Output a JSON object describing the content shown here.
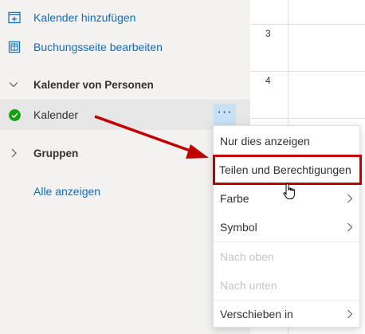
{
  "nav": {
    "add_calendar": {
      "label": "Kalender hinzufügen",
      "icon": "calendar-add-icon"
    },
    "booking_page": {
      "label": "Buchungsseite bearbeiten",
      "icon": "booking-page-icon"
    },
    "people_section": {
      "label": "Kalender von Personen",
      "icon": "chevron-down-icon"
    },
    "calendar_item": {
      "label": "Kalender",
      "checked": true,
      "more_icon": "more-horizontal-icon"
    },
    "groups_section": {
      "label": "Gruppen",
      "icon": "chevron-right-icon"
    },
    "show_all": {
      "label": "Alle anzeigen"
    }
  },
  "grid": {
    "day_numbers": [
      "3",
      "4"
    ]
  },
  "context_menu": {
    "items": [
      {
        "label": "Nur dies anzeigen",
        "disabled": false,
        "submenu": false
      },
      {
        "label": "Teilen und Berechtigungen",
        "disabled": false,
        "submenu": false,
        "highlighted": true
      },
      {
        "label": "Farbe",
        "disabled": false,
        "submenu": true
      },
      {
        "label": "Symbol",
        "disabled": false,
        "submenu": true
      },
      {
        "label": "Nach oben",
        "disabled": true,
        "submenu": false
      },
      {
        "label": "Nach unten",
        "disabled": true,
        "submenu": false
      },
      {
        "label": "Verschieben in",
        "disabled": false,
        "submenu": true
      }
    ]
  },
  "colors": {
    "accent": "#0f6cbd",
    "check_green": "#13a10e",
    "annotation_red": "#c00000",
    "nav_background": "#f3f2f1",
    "selected_row": "#e6e6e6",
    "more_button": "#c7e0f4"
  }
}
